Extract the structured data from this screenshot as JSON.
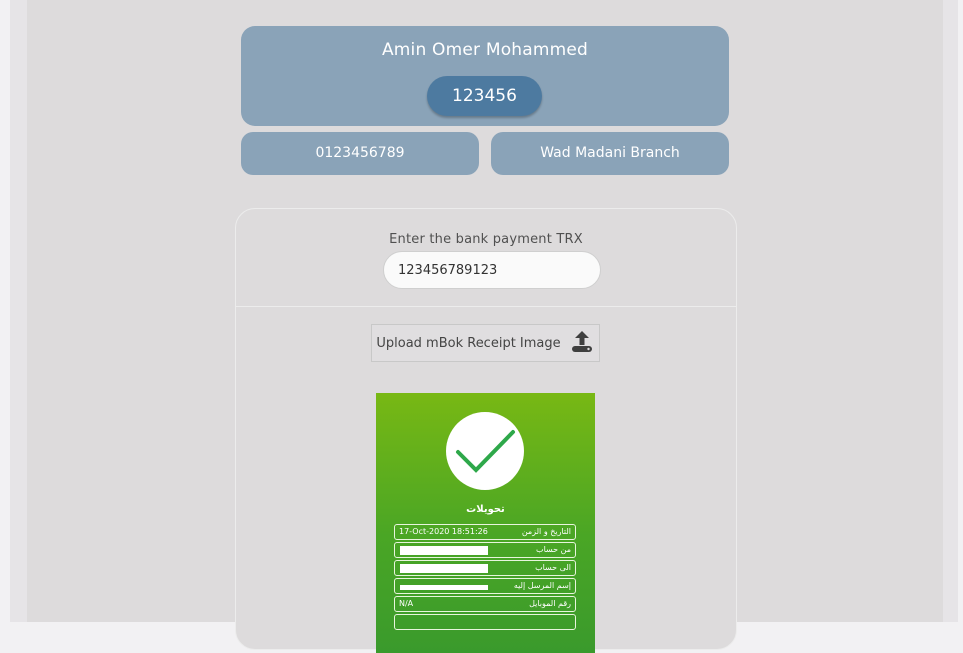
{
  "customer": {
    "name": "Amin Omer Mohammed",
    "id": "123456",
    "account": "0123456789",
    "branch": "Wad Madani Branch"
  },
  "payment_form": {
    "trx_label": "Enter the bank payment TRX",
    "trx_value": "123456789123",
    "upload_label": "Upload mBok Receipt Image"
  },
  "receipt": {
    "title": "تحويلات",
    "rows": [
      {
        "label": "التاريخ و الزمن",
        "value": "17-Oct-2020 18:51:26"
      },
      {
        "label": "من حساب",
        "value": ""
      },
      {
        "label": "الى حساب",
        "value": ""
      },
      {
        "label": "إسم المرسل إليه",
        "value": ""
      },
      {
        "label": "رقم الموبايل",
        "value": "N/A"
      }
    ]
  },
  "colors": {
    "card": "#8aa3b8",
    "pill": "#4d7aa0",
    "receipt_green": "#4aa625"
  },
  "icons": {
    "upload": "upload-icon",
    "check": "check-icon"
  }
}
